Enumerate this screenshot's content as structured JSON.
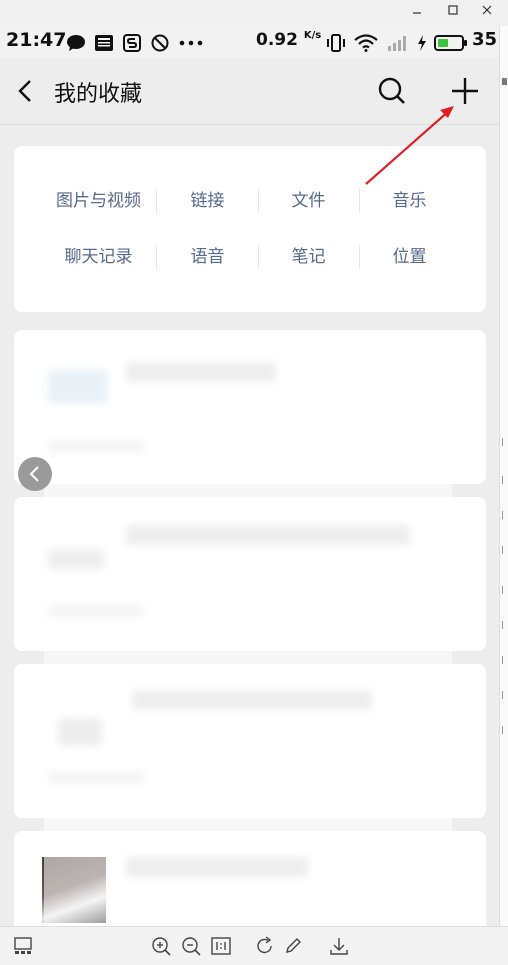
{
  "window": {
    "controls": [
      "minimize-icon",
      "maximize-icon",
      "close-icon"
    ]
  },
  "status_bar": {
    "time": "21:47",
    "net_speed": "0.92",
    "net_unit": "K/s",
    "battery": "35"
  },
  "header": {
    "title": "我的收藏",
    "back_icon": "back-arrow-icon",
    "search_icon": "search-icon",
    "add_icon": "plus-icon"
  },
  "categories": [
    {
      "label": "图片与视频"
    },
    {
      "label": "链接"
    },
    {
      "label": "文件"
    },
    {
      "label": "音乐"
    },
    {
      "label": "聊天记录"
    },
    {
      "label": "语音"
    },
    {
      "label": "笔记"
    },
    {
      "label": "位置"
    }
  ],
  "annotation": {
    "color": "#e02020"
  },
  "colors": {
    "category_text": "#566a8c",
    "background": "#ededed",
    "card": "#ffffff"
  }
}
